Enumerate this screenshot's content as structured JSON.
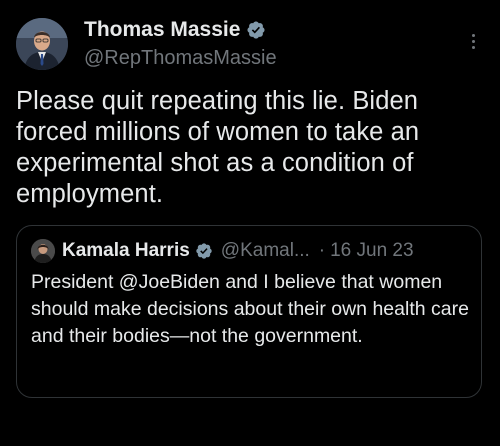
{
  "author": {
    "name": "Thomas Massie",
    "handle": "@RepThomasMassie",
    "avatar_icon": "profile-photo"
  },
  "tweet": {
    "text": "Please quit repeating this lie. Biden forced millions of women to take an experimental shot as a condition of employment."
  },
  "quoted_tweet": {
    "author_name": "Kamala Harris",
    "author_handle": "@Kamal...",
    "separator": "·",
    "date": "16 Jun 23",
    "text": "President @JoeBiden and I believe that women should make decisions about their own health care and their bodies—not the government."
  },
  "icons": {
    "verified": "verified-badge-icon",
    "more": "more-options-icon"
  },
  "colors": {
    "background": "#000000",
    "primary_text": "#e7e9ea",
    "secondary_text": "#71767b",
    "border": "#2f3336",
    "verified_badge": "#829aab"
  }
}
